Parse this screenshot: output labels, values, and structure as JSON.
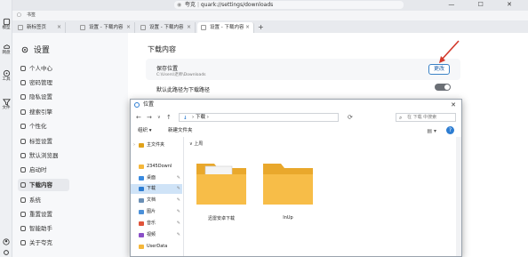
{
  "browser": {
    "address": "quark://settings/downloads",
    "site_chip": "夸克",
    "bookmark": "书签",
    "tabs": [
      {
        "label": "新标签页"
      },
      {
        "label": "设置 - 下载内容"
      },
      {
        "label": "设置 - 下载内容"
      },
      {
        "label": "设置 - 下载内容"
      }
    ],
    "new_tab": "+",
    "window_controls": "— ☐ ✕"
  },
  "rail": {
    "items": [
      {
        "label": "模型"
      },
      {
        "label": "网盘"
      },
      {
        "label": "工具"
      },
      {
        "label": "文件"
      }
    ]
  },
  "settings": {
    "title": "设置",
    "sidebar": [
      {
        "label": "个人中心"
      },
      {
        "label": "密码管理"
      },
      {
        "label": "隐私设置"
      },
      {
        "label": "搜索引擎"
      },
      {
        "label": "个性化"
      },
      {
        "label": "标签设置"
      },
      {
        "label": "默认浏览器"
      },
      {
        "label": "启动时"
      },
      {
        "label": "下载内容"
      },
      {
        "label": "系统"
      },
      {
        "label": "重置设置"
      },
      {
        "label": "智能助手"
      },
      {
        "label": "关于夸克"
      }
    ],
    "section_title": "下载内容",
    "save_location_label": "保存位置",
    "save_location_path": "C:\\Users\\老师\\Downloads",
    "change_button": "更改",
    "default_download_label": "默认此路径为下载路径",
    "toggle_state": "off"
  },
  "dialog": {
    "title": "位置",
    "close": "✕",
    "path": "下载",
    "search_placeholder": "在 下载 中搜索",
    "organize": "组织 ▾",
    "new_folder": "新建文件夹",
    "help": "?",
    "tree": [
      {
        "label": "主文件夹",
        "icon": "home-icon"
      },
      {
        "label": "2345Downl",
        "icon": "folder-icon"
      },
      {
        "label": "桌面",
        "icon": "desktop-icon"
      },
      {
        "label": "下载",
        "icon": "download-icon"
      },
      {
        "label": "文档",
        "icon": "document-icon"
      },
      {
        "label": "图片",
        "icon": "picture-icon"
      },
      {
        "label": "音乐",
        "icon": "music-icon"
      },
      {
        "label": "视频",
        "icon": "video-icon"
      },
      {
        "label": "UserData",
        "icon": "folder-icon"
      }
    ],
    "up_label": "上周",
    "folders": [
      {
        "name": "迅雷安卓下载"
      },
      {
        "name": "InUp"
      }
    ]
  },
  "colors": {
    "accent": "#2d7dd2",
    "folder": "#f5b73b",
    "arrow": "#d33a2c"
  }
}
